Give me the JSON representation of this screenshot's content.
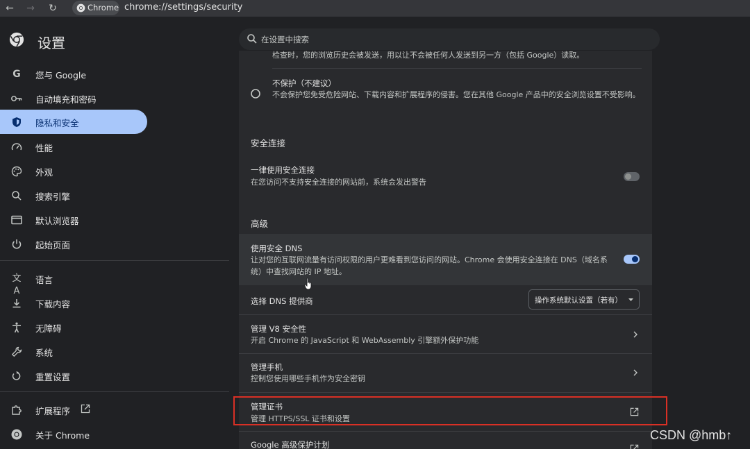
{
  "browser": {
    "chip_label": "Chrome",
    "url": "chrome://settings/security"
  },
  "header": {
    "title": "设置",
    "search_placeholder": "在设置中搜索"
  },
  "sidebar": {
    "items": [
      {
        "label": "您与 Google",
        "icon": "google-icon"
      },
      {
        "label": "自动填充和密码",
        "icon": "key-icon"
      },
      {
        "label": "隐私和安全",
        "icon": "shield-icon",
        "active": true
      },
      {
        "label": "性能",
        "icon": "speedometer-icon"
      },
      {
        "label": "外观",
        "icon": "palette-icon"
      },
      {
        "label": "搜索引擎",
        "icon": "search-icon"
      },
      {
        "label": "默认浏览器",
        "icon": "browser-window-icon"
      },
      {
        "label": "起始页面",
        "icon": "power-icon"
      },
      {
        "label": "语言",
        "icon": "translate-icon"
      },
      {
        "label": "下载内容",
        "icon": "download-icon"
      },
      {
        "label": "无障碍",
        "icon": "accessibility-icon"
      },
      {
        "label": "系统",
        "icon": "wrench-icon"
      },
      {
        "label": "重置设置",
        "icon": "reset-icon"
      },
      {
        "label": "扩展程序",
        "icon": "puzzle-icon"
      },
      {
        "label": "关于 Chrome",
        "icon": "chrome-icon"
      }
    ]
  },
  "content": {
    "cut_text": "检查时，您的浏览历史会被发送，用以让不会被任何人发送到另一方（包括 Google）读取。",
    "no_protection": {
      "title": "不保护（不建议）",
      "desc": "不会保护您免受危险网站、下载内容和扩展程序的侵害。您在其他 Google 产品中的安全浏览设置不受影响。"
    },
    "secure_connections_heading": "安全连接",
    "always_https": {
      "title": "一律使用安全连接",
      "desc": "在您访问不支持安全连接的网站前，系统会发出警告",
      "enabled": false
    },
    "advanced_heading": "高级",
    "secure_dns": {
      "title": "使用安全 DNS",
      "desc": "让对您的互联网流量有访问权限的用户更难看到您访问的网站。Chrome 会使用安全连接在 DNS（域名系统）中查找网站的 IP 地址。",
      "enabled": true
    },
    "dns_provider": {
      "label": "选择 DNS 提供商",
      "selected": "操作系统默认设置（若有）"
    },
    "v8": {
      "title": "管理 V8 安全性",
      "desc": "开启 Chrome 的 JavaScript 和 WebAssembly 引擎额外保护功能"
    },
    "phones": {
      "title": "管理手机",
      "desc": "控制您使用哪些手机作为安全密钥"
    },
    "certs": {
      "title": "管理证书",
      "desc": "管理 HTTPS/SSL 证书和设置"
    },
    "advanced_protection": {
      "title": "Google 高级保护计划"
    }
  },
  "watermark": "CSDN @hmb↑",
  "colors": {
    "accent": "#a8c7fa",
    "toggle_on": "#a8c7fa",
    "toggle_knob_on": "#062e6f",
    "highlight_box": "#d93025"
  }
}
